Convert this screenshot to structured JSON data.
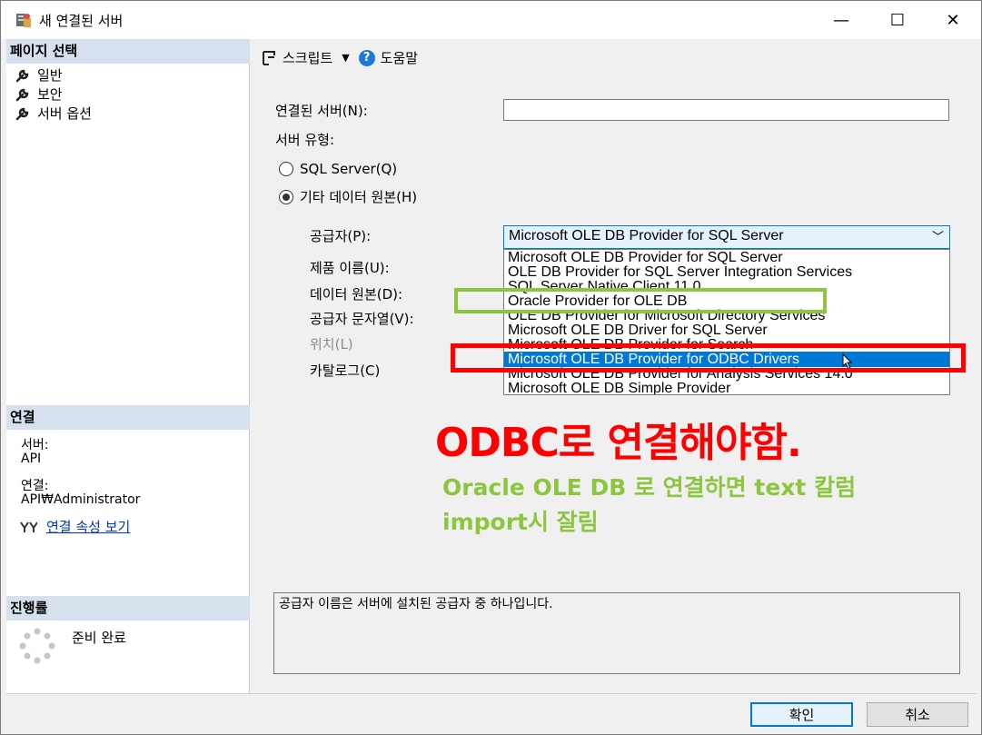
{
  "window": {
    "title": "새 연결된 서버",
    "controls": {
      "minimize": "—",
      "maximize": "☐",
      "close": "✕"
    }
  },
  "left": {
    "page_select_header": "페이지 선택",
    "nav": [
      "일반",
      "보안",
      "서버 옵션"
    ],
    "connection_header": "연결",
    "server_label": "서버:",
    "server_value": "API",
    "connection_label": "연결:",
    "connection_value": "API₩Administrator",
    "view_props_link": "연결 속성 보기",
    "progress_header": "진행률",
    "progress_status": "준비 완료"
  },
  "toolbar": {
    "script_label": "스크립트",
    "script_arrow": "▼",
    "help_glyph": "?",
    "help_label": "도움말"
  },
  "form": {
    "linked_server_label": "연결된 서버(N):",
    "linked_server_value": "",
    "server_type_label": "서버 유형:",
    "radio_sql": "SQL Server(Q)",
    "radio_other": "기타 데이터 원본(H)",
    "provider_label": "공급자(P):",
    "product_label": "제품 이름(U):",
    "datasource_label": "데이터 원본(D):",
    "provider_string_label": "공급자 문자열(V):",
    "location_label": "위치(L)",
    "catalog_label": "카탈로그(C)",
    "provider_selected": "Microsoft OLE DB Provider for SQL Server",
    "combo_chevron": "﹀",
    "provider_options": [
      "Microsoft OLE DB Provider for SQL Server",
      "OLE DB Provider for SQL Server Integration Services",
      "SQL Server Native Client 11.0",
      "Oracle Provider for OLE DB",
      "OLE DB Provider for Microsoft Directory Services",
      "Microsoft OLE DB Driver for SQL Server",
      "Microsoft OLE DB Provider for Search",
      "Microsoft OLE DB Provider for ODBC Drivers",
      "Microsoft OLE DB Provider for Analysis Services 14.0",
      "Microsoft OLE DB Simple Provider"
    ],
    "highlighted_option_index": 7,
    "description": "공급자 이름은 서버에 설치된 공급자 중 하나입니다."
  },
  "annotations": {
    "red_note": "ODBC로 연결해야함.",
    "green_note_line1": "Oracle OLE DB 로 연결하면 text 칼럼",
    "green_note_line2": "import시 잘림",
    "red_color": "#ff0000",
    "green_color": "#8cc63f"
  },
  "buttons": {
    "ok": "확인",
    "cancel": "취소"
  }
}
